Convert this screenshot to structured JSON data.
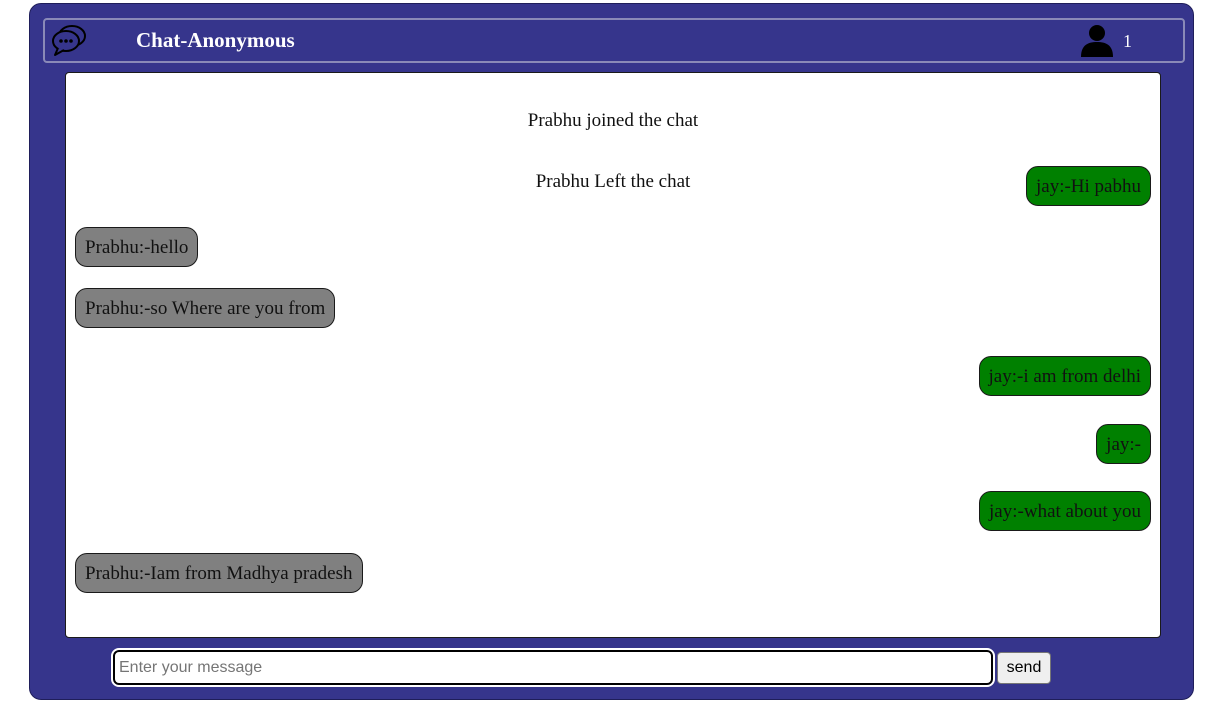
{
  "header": {
    "logo_icon": "chat-bubbles-icon",
    "title": "Chat-Anonymous",
    "user_icon": "user-icon",
    "online_count": "1"
  },
  "colors": {
    "frame": "#36358c",
    "incoming_bubble": "#808080",
    "outgoing_bubble": "#008000"
  },
  "messages": [
    {
      "type": "notice",
      "text": "Prabhu joined the chat"
    },
    {
      "type": "notice",
      "text": "Prabhu Left the chat"
    },
    {
      "type": "outgoing",
      "text": "jay:-Hi pabhu"
    },
    {
      "type": "incoming",
      "text": "Prabhu:-hello"
    },
    {
      "type": "incoming",
      "text": "Prabhu:-so Where are you from"
    },
    {
      "type": "outgoing",
      "text": "jay:-i am from delhi"
    },
    {
      "type": "outgoing",
      "text": "jay:-"
    },
    {
      "type": "outgoing",
      "text": "jay:-what about you"
    },
    {
      "type": "incoming",
      "text": "Prabhu:-Iam from Madhya pradesh"
    }
  ],
  "composer": {
    "placeholder": "Enter your message",
    "value": "",
    "send_label": "send"
  }
}
